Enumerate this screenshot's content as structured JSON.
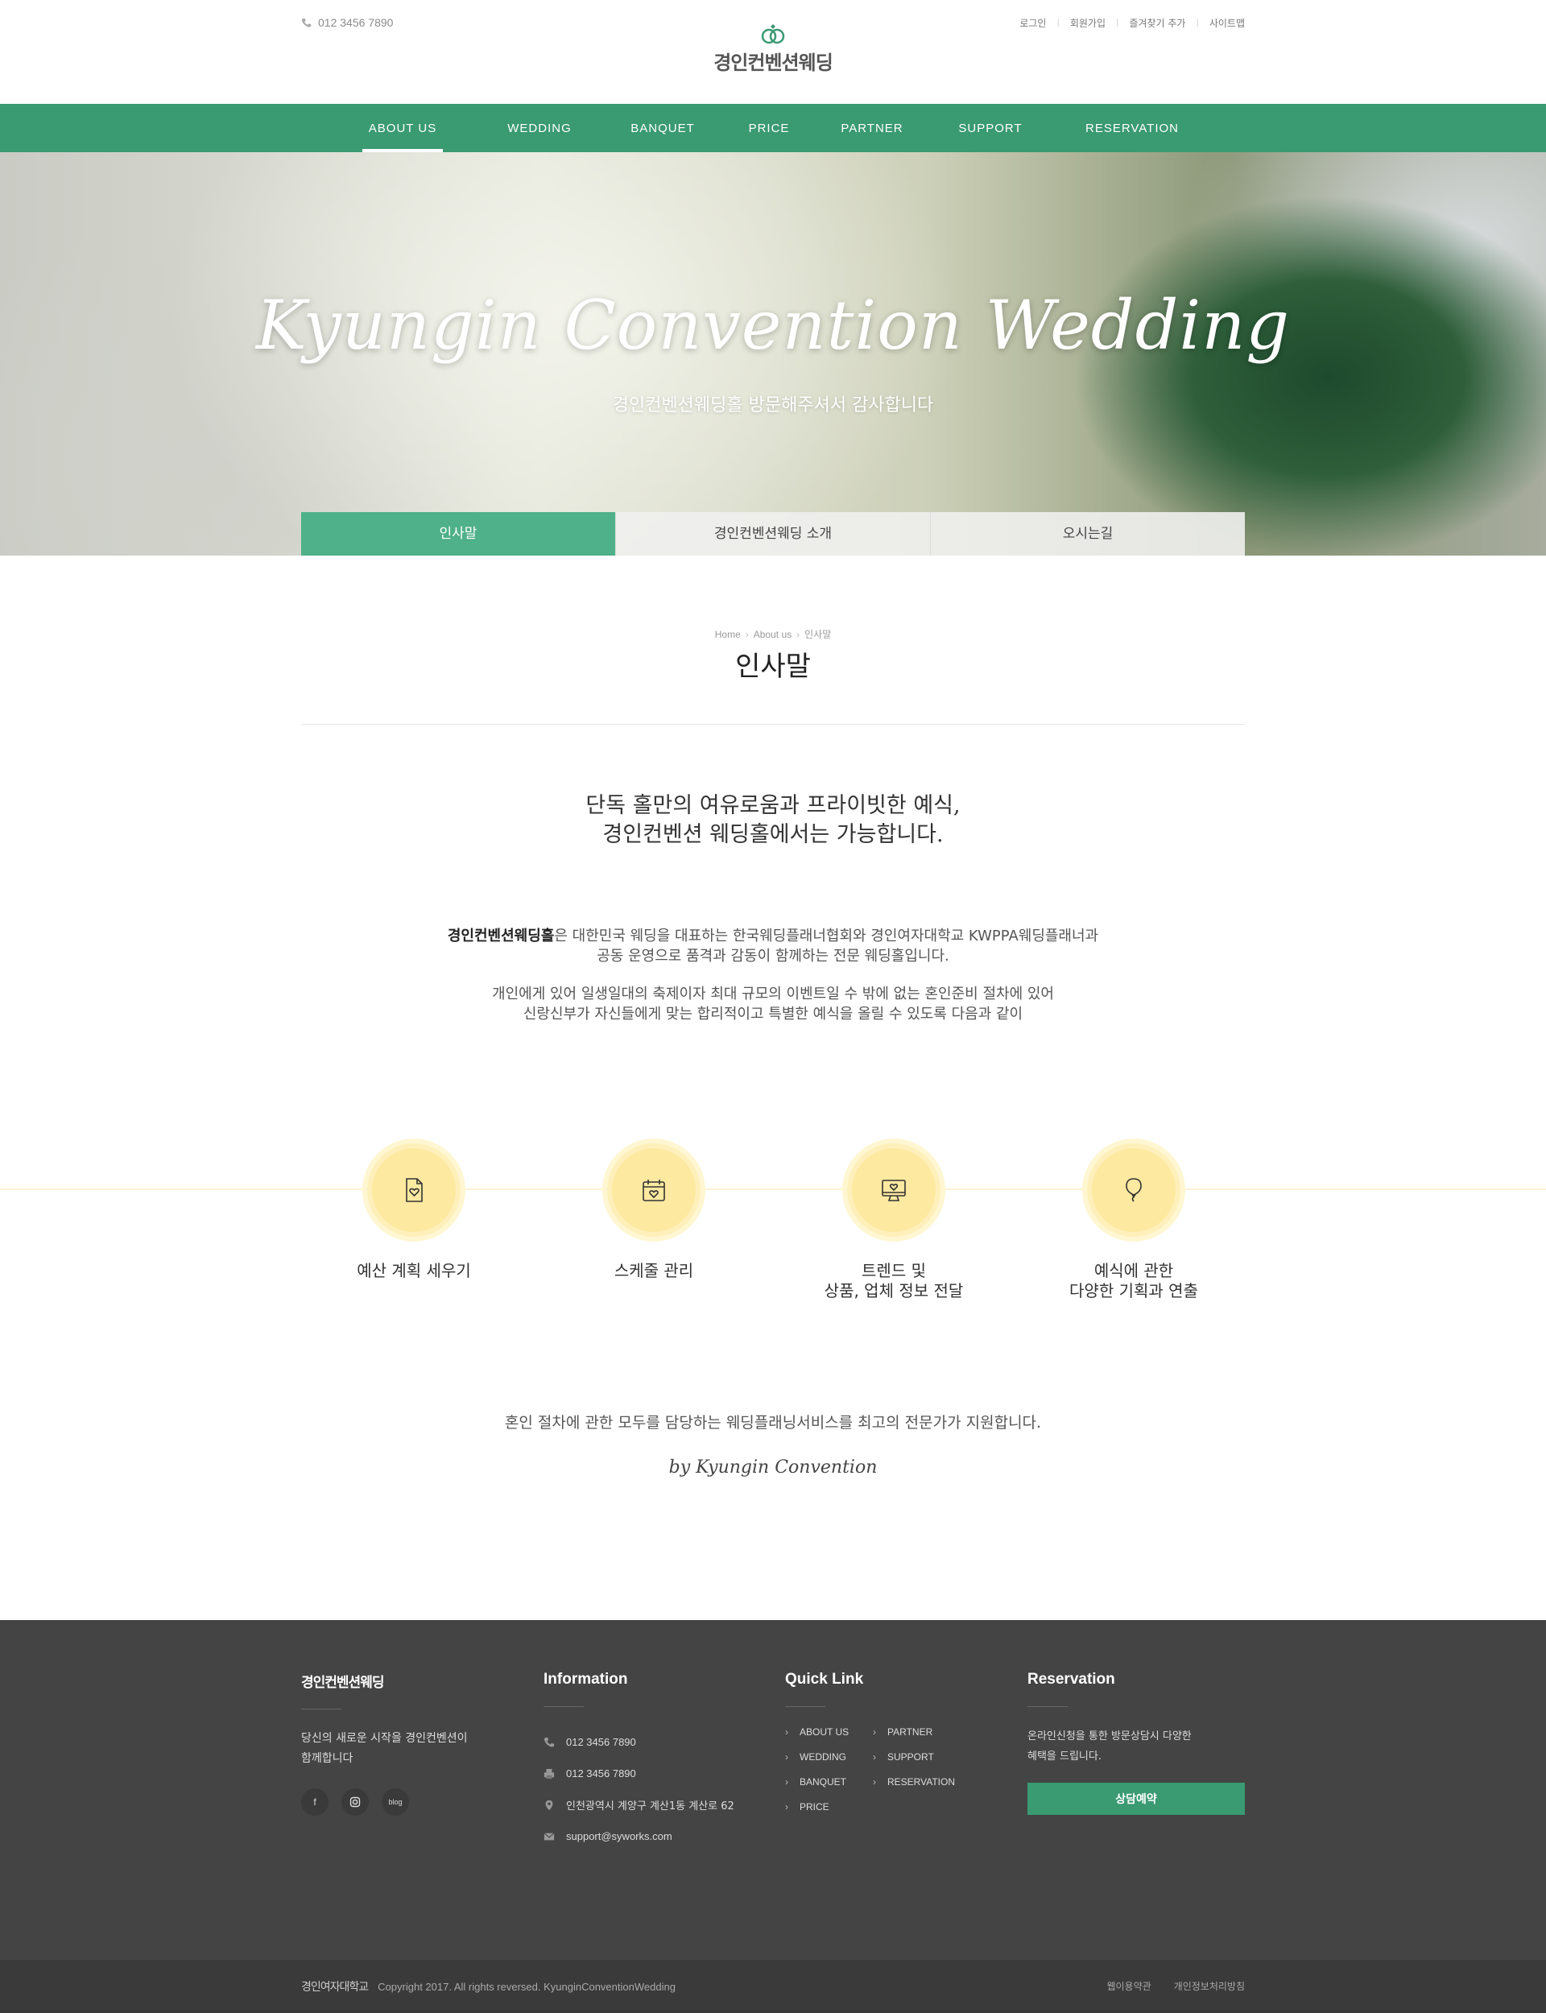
{
  "top": {
    "phone": "012 3456 7890",
    "links": [
      "로그인",
      "회원가입",
      "즐겨찾기 추가",
      "사이트맵"
    ],
    "logo_text": "경인컨벤션웨딩"
  },
  "nav": [
    "ABOUT US",
    "WEDDING",
    "BANQUET",
    "PRICE",
    "PARTNER",
    "SUPPORT",
    "RESERVATION"
  ],
  "hero": {
    "title": "Kyungin Convention Wedding",
    "subtitle": "경인컨벤션웨딩홀 방문해주셔서 감사합니다"
  },
  "subtabs": [
    "인사말",
    "경인컨벤션웨딩 소개",
    "오시는길"
  ],
  "breadcrumb": [
    "Home",
    "About us",
    "인사말"
  ],
  "page_title": "인사말",
  "headline": [
    "단독 홀만의 여유로움과 프라이빗한 예식,",
    "경인컨벤션 웨딩홀에서는 가능합니다."
  ],
  "intro": {
    "bold": "경인컨벤션웨딩홀",
    "line1_rest": "은 대한민국 웨딩을 대표하는 한국웨딩플래너협회와 경인여자대학교 KWPPA웨딩플래너과",
    "line2": "공동 운영으로 품격과 감동이 함께하는 전문 웨딩홀입니다.",
    "line3": "개인에게 있어 일생일대의 축제이자 최대 규모의 이벤트일 수 밖에 없는 혼인준비 절차에 있어",
    "line4": "신랑신부가 자신들에게 맞는 합리적이고 특별한 예식을 올릴 수 있도록 다음과 같이"
  },
  "features": [
    {
      "icon": "budget-doc-heart-icon",
      "line1": "예산 계획 세우기",
      "line2": ""
    },
    {
      "icon": "calendar-heart-icon",
      "line1": "스케줄 관리",
      "line2": ""
    },
    {
      "icon": "monitor-heart-icon",
      "line1": "트렌드 및",
      "line2": "상품, 업체 정보 전달"
    },
    {
      "icon": "balloon-icon",
      "line1": "예식에 관한",
      "line2": "다양한 기획과 연출"
    }
  ],
  "closing": "혼인 절차에 관한 모두를 담당하는 웨딩플래닝서비스를 최고의 전문가가 지원합니다.",
  "signature": "by Kyungin Convention",
  "footer": {
    "about": {
      "title": "경인컨벤션웨딩",
      "text1": "당신의 새로운 시작을 경인컨벤션이",
      "text2": "함께합니다",
      "social": [
        "f",
        "ig",
        "blog"
      ]
    },
    "info": {
      "title": "Information",
      "phone": "012 3456 7890",
      "fax": "012 3456 7890",
      "address": "인천광역시 계양구 계산1동 계산로 62",
      "email": "support@syworks.com"
    },
    "quick": {
      "title": "Quick Link",
      "links": [
        "ABOUT US",
        "PARTNER",
        "WEDDING",
        "SUPPORT",
        "BANQUET",
        "RESERVATION",
        "PRICE"
      ]
    },
    "reservation": {
      "title": "Reservation",
      "text1": "온라인신청을 통한 방문상담시 다양한",
      "text2": "혜택을 드립니다.",
      "button": "상담예약"
    }
  },
  "bottom": {
    "uni_logo": "경인여자대학교",
    "copyright": "Copyright 2017. All rights reversed. KyunginConventionWedding",
    "terms": "웹이용약관",
    "privacy": "개인정보처리방침"
  },
  "colors": {
    "brand_green": "#3a9a72",
    "subtab_active": "#4fb189",
    "feature_yellow": "#fde9a0",
    "footer_bg": "#444444"
  }
}
